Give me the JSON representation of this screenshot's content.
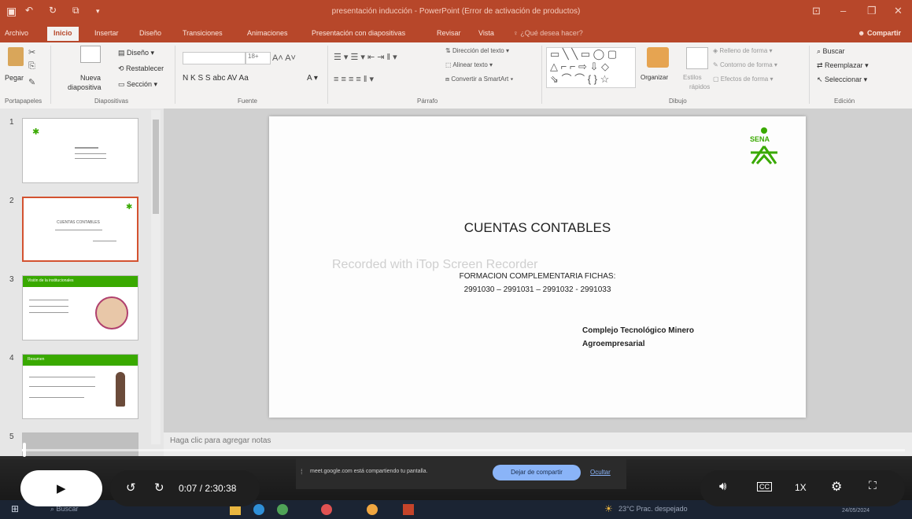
{
  "window": {
    "title": "presentación inducción - PowerPoint (Error de activación de productos)",
    "share_label": "Compartir"
  },
  "tabs": [
    "Archivo",
    "Inicio",
    "Insertar",
    "Diseño",
    "Transiciones",
    "Animaciones",
    "Presentación con diapositivas",
    "Revisar",
    "Vista",
    "¿Qué desea hacer?"
  ],
  "ribbon": {
    "paste": "Pegar",
    "new_slide_1": "Nueva",
    "new_slide_2": "diapositiva",
    "layout": "Diseño",
    "reset": "Restablecer",
    "section": "Sección",
    "font_size": "18+",
    "font_letters": "N  K  S  S  abc  AV  Aa",
    "text_direction": "Dirección del texto",
    "align_text": "Alinear texto",
    "smartart": "Convertir a SmartArt",
    "organize": "Organizar",
    "quick_styles_1": "Estilos",
    "quick_styles_2": "rápidos",
    "shape_fill": "Relleno de forma",
    "shape_outline": "Contorno de forma",
    "shape_effects": "Efectos de forma",
    "find": "Buscar",
    "replace": "Reemplazar",
    "select": "Seleccionar",
    "groups": [
      "Portapapeles",
      "Diapositivas",
      "Fuente",
      "Párrafo",
      "Dibujo",
      "Edición"
    ]
  },
  "thumbnails": [
    {
      "num": "1"
    },
    {
      "num": "2",
      "title": "CUENTAS CONTABLES"
    },
    {
      "num": "3",
      "header": "Visión de la institucionales"
    },
    {
      "num": "4",
      "header": "Resumen"
    },
    {
      "num": "5"
    }
  ],
  "slide": {
    "logo_text": "SENA",
    "title": "CUENTAS CONTABLES",
    "watermark": "Recorded with iTop Screen Recorder",
    "subtitle": "FORMACION COMPLEMENTARIA FICHAS:",
    "fichas": "2991030 – 2991031 – 2991032 - 2991033",
    "org_line1": "Complejo Tecnológico Minero",
    "org_line2": "Agroempresarial"
  },
  "notes_placeholder": "Haga clic para agregar notas",
  "meet": {
    "message": "meet.google.com está compartiendo tu pantalla.",
    "stop": "Dejar de compartir",
    "hide": "Ocultar"
  },
  "player": {
    "time": "0:07 / 2:30:38",
    "speed": "1X",
    "progress": 0.001,
    "rewind_seconds": "10",
    "forward_seconds": "10"
  },
  "taskbar": {
    "search": "Buscar",
    "weather": "23°C  Prac. despejado",
    "date": "24/05/2024"
  },
  "colors": {
    "accent": "#b7472a",
    "selection": "#d35230",
    "sena_green": "#39a900"
  }
}
